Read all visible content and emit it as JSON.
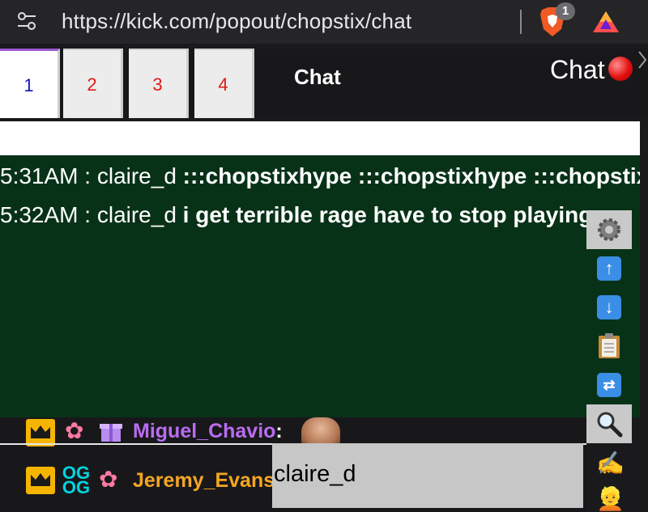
{
  "browser": {
    "url": "https://kick.com/popout/chopstix/chat",
    "brave_badge_count": "1"
  },
  "tabs": [
    {
      "label": "1"
    },
    {
      "label": "2"
    },
    {
      "label": "3"
    },
    {
      "label": "4"
    }
  ],
  "header": {
    "chat_tab_label": "Chat",
    "chat_status_label": "Chat"
  },
  "log": {
    "lines": [
      {
        "time": "5:31AM",
        "sep": " : ",
        "user": "claire_d",
        "message": " :::chopstixhype :::chopstixhype :::chopstixhype"
      },
      {
        "time": "5:32AM",
        "sep": " : ",
        "user": "claire_d",
        "message": " i get terrible rage have to stop playing"
      }
    ]
  },
  "toolbar": {
    "items": [
      "gear-icon",
      "up-arrow-icon",
      "down-arrow-icon",
      "clipboard-icon",
      "shuffle-icon",
      "search-icon",
      "writing-hand-icon",
      "person-icon"
    ]
  },
  "chat": {
    "messages": [
      {
        "username": "Miguel_Chavio",
        "separator": ":",
        "color": "#b96cf0"
      },
      {
        "username": "Jeremy_Evans",
        "color": "#f5a623"
      }
    ]
  },
  "input": {
    "value": "claire_d"
  },
  "colors": {
    "log_bg": "#083218",
    "active_tab_text": "#1515c8",
    "inactive_tab_text": "#e01818"
  }
}
